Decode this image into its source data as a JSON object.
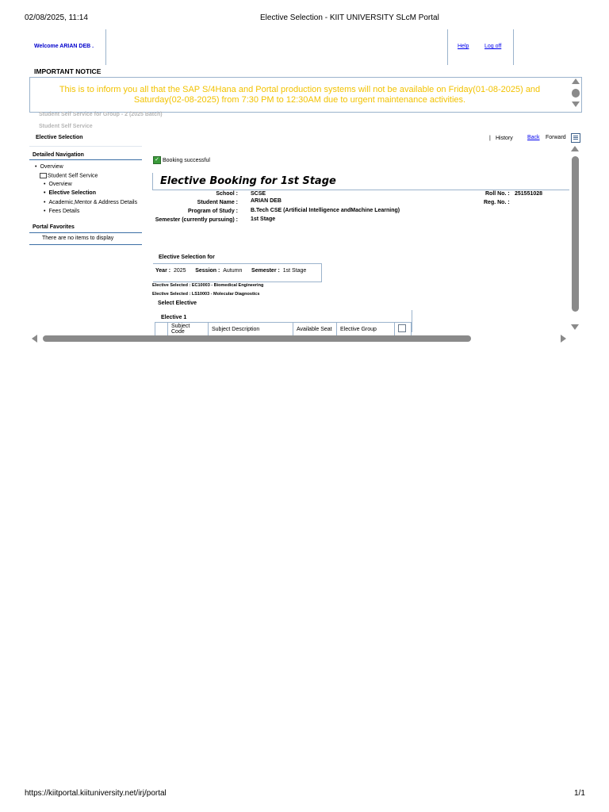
{
  "print_header": {
    "datetime": "02/08/2025, 11:14",
    "title": "Elective Selection - KIIT UNIVERSITY SLcM Portal"
  },
  "print_footer": {
    "url": "https://kiitportal.kiituniversity.net/irj/portal",
    "page": "1/1"
  },
  "header": {
    "welcome": "Welcome ARIAN DEB .",
    "help": "Help",
    "logoff": "Log off"
  },
  "notice": {
    "title": "IMPORTANT NOTICE",
    "line1": "This is to inform you all that the SAP S/4Hana and Portal production systems will not be available on Friday(01-08-2025) and",
    "line2": "Saturday(02-08-2025) from 7:30 PM to 12:30AM due to urgent maintenance activities.",
    "color": "#f2c200"
  },
  "breadcrumbs": {
    "group": "Student Self Service for Group - 2 (2025 Batch)",
    "service": "Student Self Service",
    "current": "Elective Selection"
  },
  "history_bar": {
    "history": "History",
    "back": "Back",
    "forward": "Forward"
  },
  "detailed_nav": {
    "title": "Detailed Navigation",
    "overview": "Overview",
    "student_self_service": "Student Self Service",
    "items": [
      "Overview",
      "Elective Selection",
      "Academic,Mentor & Address Details",
      "Fees Details"
    ]
  },
  "portal_favorites": {
    "title": "Portal Favorites",
    "empty": "There are no items to display"
  },
  "booking": {
    "status": "Booking successful",
    "title": "Elective Booking for 1st Stage",
    "school_label": "School :",
    "school": "SCSE",
    "name_label": "Student Name :",
    "name": "ARIAN  DEB",
    "program_label": "Program of Study :",
    "program": "B.Tech CSE (Artificial Intelligence andMachine Learning)",
    "semester_label": "Semester (currently pursuing) :",
    "semester": "1st Stage",
    "roll_label": "Roll No. :",
    "roll": "251551028",
    "reg_label": "Reg. No. :"
  },
  "elective_selection": {
    "title": "Elective Selection for",
    "year_label": "Year :",
    "year": "2025",
    "session_label": "Session :",
    "session": "Autumn",
    "semester_label": "Semester :",
    "semester": "1st Stage",
    "selected1": "Elective Selected : EC10003 - Biomedical Engineering",
    "selected2": "Elective Selected : LS10003 - Molecular Diagnostics",
    "select_elective": "Select Elective",
    "elective1": "Elective 1",
    "columns": [
      "Subject Code",
      "Subject Description",
      "Available Seat",
      "Elective Group"
    ]
  }
}
